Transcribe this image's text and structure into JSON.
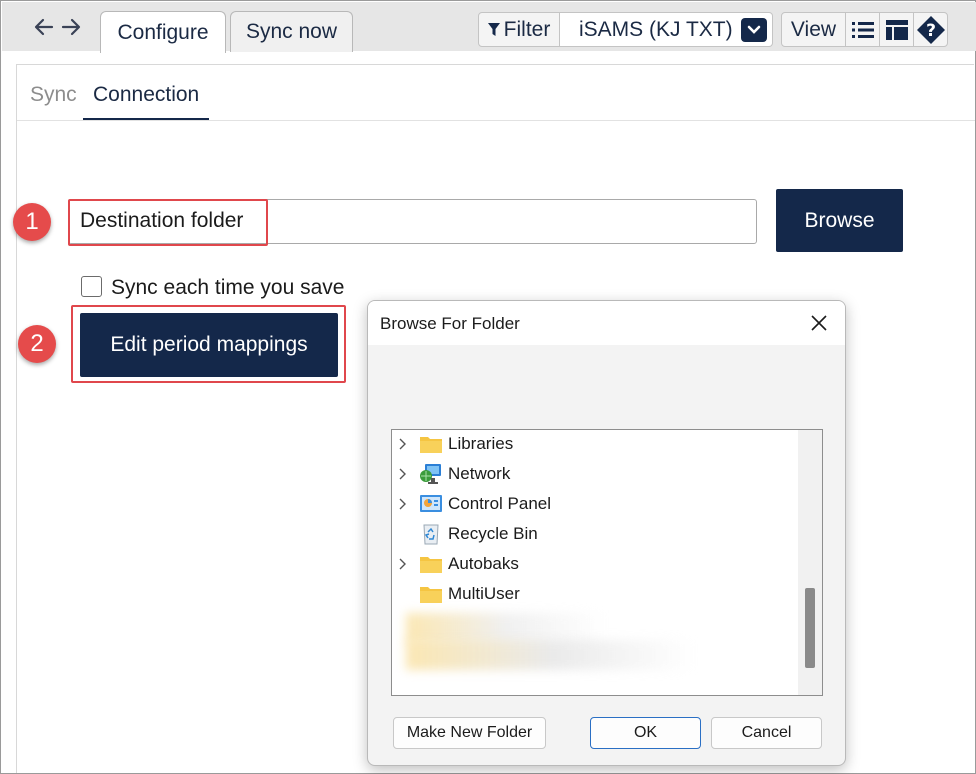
{
  "toolbar": {
    "back_icon": "arrow-left-icon",
    "forward_icon": "arrow-right-icon",
    "tabs": [
      {
        "label": "Configure",
        "active": true
      },
      {
        "label": "Sync now",
        "active": false
      }
    ],
    "filter_label": "Filter",
    "filter_value": "iSAMS (KJ TXT)",
    "view_label": "View"
  },
  "subtabs": [
    {
      "label": "Sync",
      "active": false
    },
    {
      "label": "Connection",
      "active": true
    }
  ],
  "form": {
    "destination_placeholder": "Destination folder",
    "destination_value": "",
    "browse_label": "Browse",
    "sync_checkbox_label": "Sync each time you save",
    "sync_checked": false,
    "edit_mappings_label": "Edit period mappings"
  },
  "annotations": [
    {
      "number": "1"
    },
    {
      "number": "2"
    }
  ],
  "dialog": {
    "title": "Browse For Folder",
    "tree": [
      {
        "label": "Libraries",
        "icon": "folder-icon",
        "expandable": true
      },
      {
        "label": "Network",
        "icon": "network-icon",
        "expandable": true
      },
      {
        "label": "Control Panel",
        "icon": "control-panel-icon",
        "expandable": true
      },
      {
        "label": "Recycle Bin",
        "icon": "recycle-bin-icon",
        "expandable": false
      },
      {
        "label": "Autobaks",
        "icon": "folder-icon",
        "expandable": true
      },
      {
        "label": "MultiUser",
        "icon": "folder-icon",
        "expandable": false
      }
    ],
    "buttons": {
      "new_folder": "Make New Folder",
      "ok": "OK",
      "cancel": "Cancel"
    }
  },
  "colors": {
    "primary": "#14284a",
    "annotation": "#e54b4b",
    "folder": "#f5c542"
  }
}
